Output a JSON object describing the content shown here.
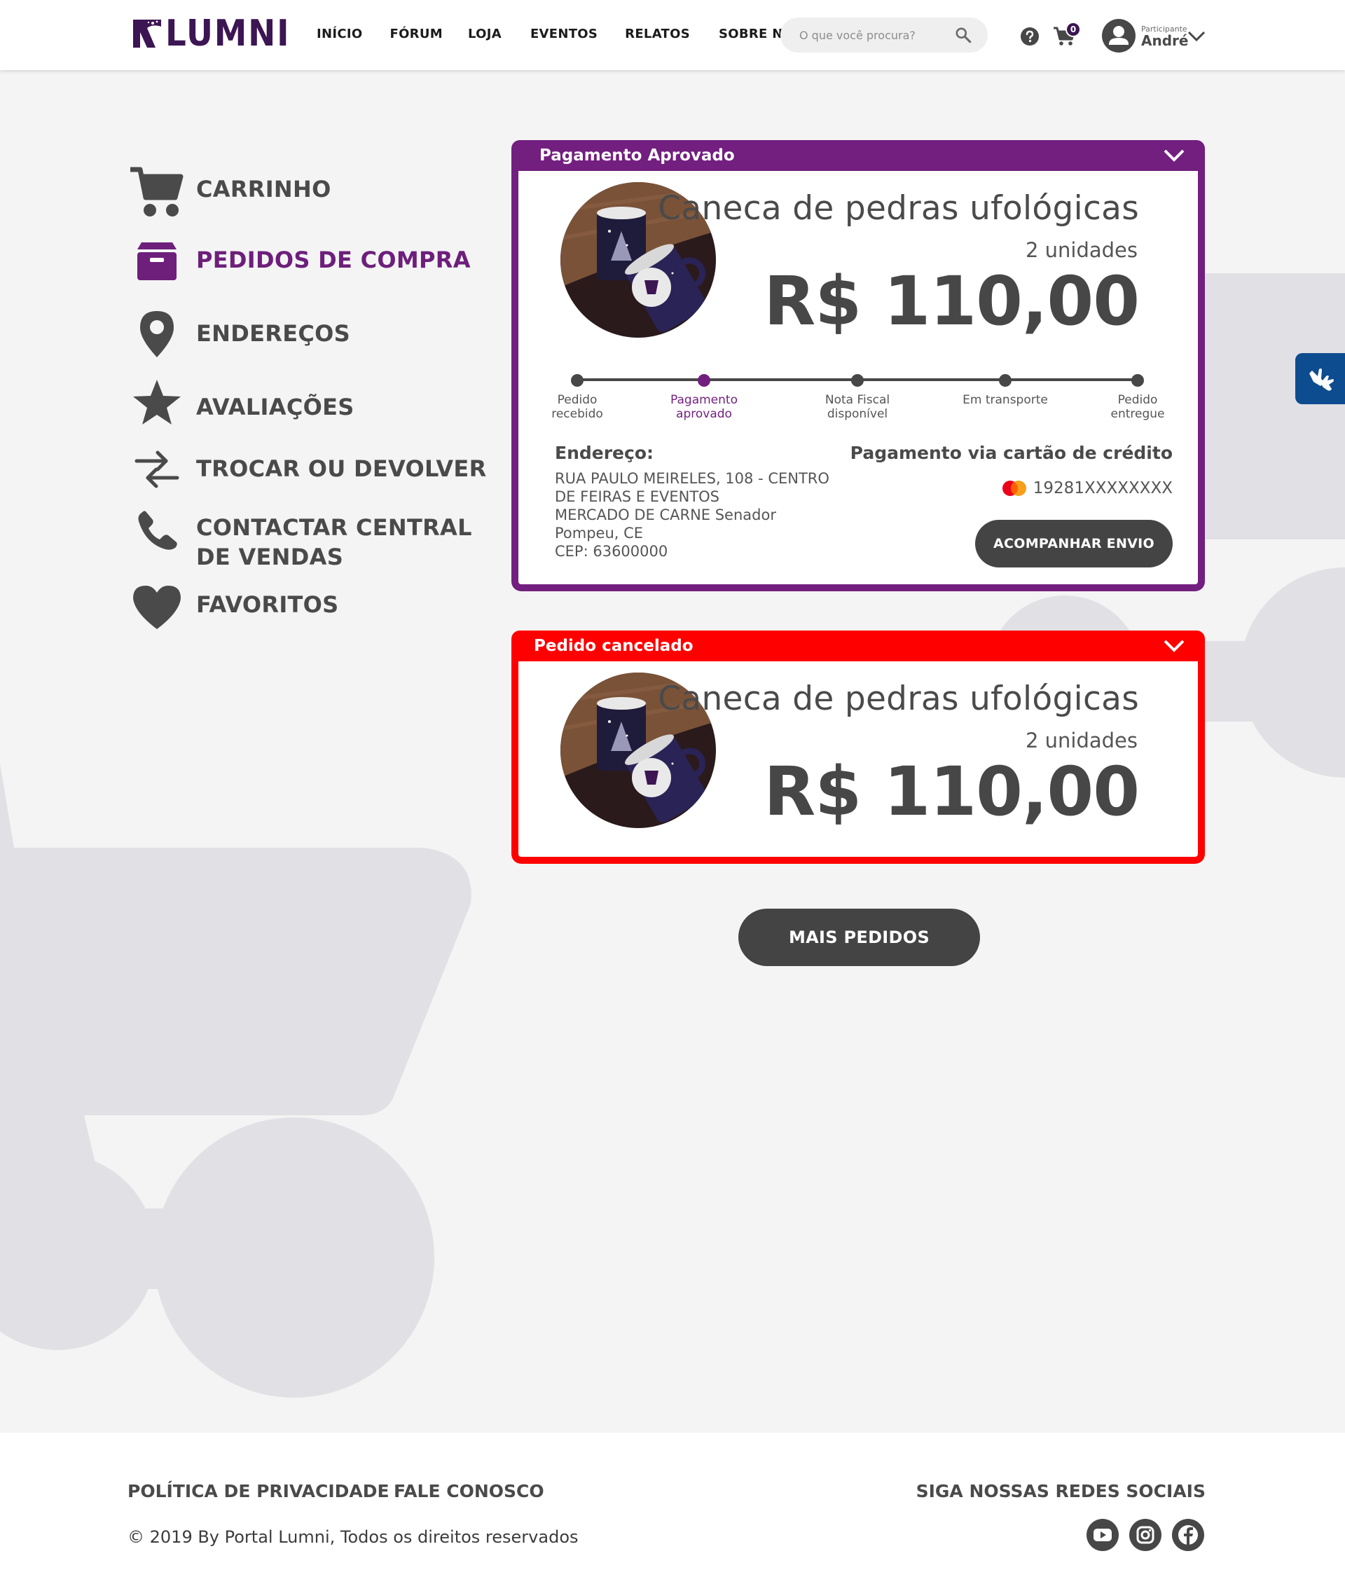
{
  "header": {
    "logo_text": "LUMNI",
    "nav": [
      "INÍCIO",
      "FÓRUM",
      "LOJA",
      "EVENTOS",
      "RELATOS",
      "SOBRE NÓS"
    ],
    "search_placeholder": "O que você procura?",
    "cart_count": "0",
    "user_role": "Participante",
    "user_name": "André"
  },
  "sidebar": {
    "items": [
      {
        "label": "CARRINHO",
        "icon": "cart-icon"
      },
      {
        "label": "PEDIDOS DE COMPRA",
        "icon": "box-icon",
        "active": true
      },
      {
        "label": "ENDEREÇOS",
        "icon": "location-pin-icon"
      },
      {
        "label": "AVALIAÇÕES",
        "icon": "star-icon"
      },
      {
        "label": "TROCAR OU DEVOLVER",
        "icon": "exchange-arrows-icon"
      },
      {
        "label_line1": "CONTACTAR CENTRAL",
        "label_line2": "DE VENDAS",
        "icon": "phone-icon"
      },
      {
        "label": "FAVORITOS",
        "icon": "heart-icon"
      }
    ]
  },
  "orders": [
    {
      "status": "Pagamento Aprovado",
      "status_color": "#721f7f",
      "product": "Caneca de pedras ufológicas",
      "units": "2 unidades",
      "price": "R$ 110,00",
      "steps": [
        {
          "line1": "Pedido",
          "line2": "recebido"
        },
        {
          "line1": "Pagamento",
          "line2": "aprovado",
          "active": true
        },
        {
          "line1": "Nota Fiscal",
          "line2": "disponível"
        },
        {
          "line1": "Em transporte",
          "line2": ""
        },
        {
          "line1": "Pedido",
          "line2": "entregue"
        }
      ],
      "current_step": 2,
      "address_title": "Endereço:",
      "address_lines": [
        "RUA PAULO MEIRELES, 108 - CENTRO",
        "DE FEIRAS E EVENTOS",
        "MERCADO DE CARNE  Senador",
        "Pompeu, CE",
        "CEP: 63600000"
      ],
      "payment_title": "Pagamento via cartão de crédito",
      "card_brand": "mastercard-icon",
      "card_number": "19281XXXXXXXX",
      "track_button": "ACOMPANHAR ENVIO"
    },
    {
      "status": "Pedido cancelado",
      "status_color": "#ff0000",
      "product": "Caneca de pedras ufológicas",
      "units": "2 unidades",
      "price": "R$ 110,00"
    }
  ],
  "more_button": "MAIS PEDIDOS",
  "footer": {
    "privacy": "POLÍTICA DE PRIVACIDADE",
    "contact": "FALE CONOSCO",
    "social_title": "SIGA NOSSAS REDES SOCIAIS",
    "copyright": "© 2019 By Portal Lumni, Todos os direitos reservados",
    "social": [
      "youtube-icon",
      "instagram-icon",
      "facebook-icon"
    ]
  }
}
